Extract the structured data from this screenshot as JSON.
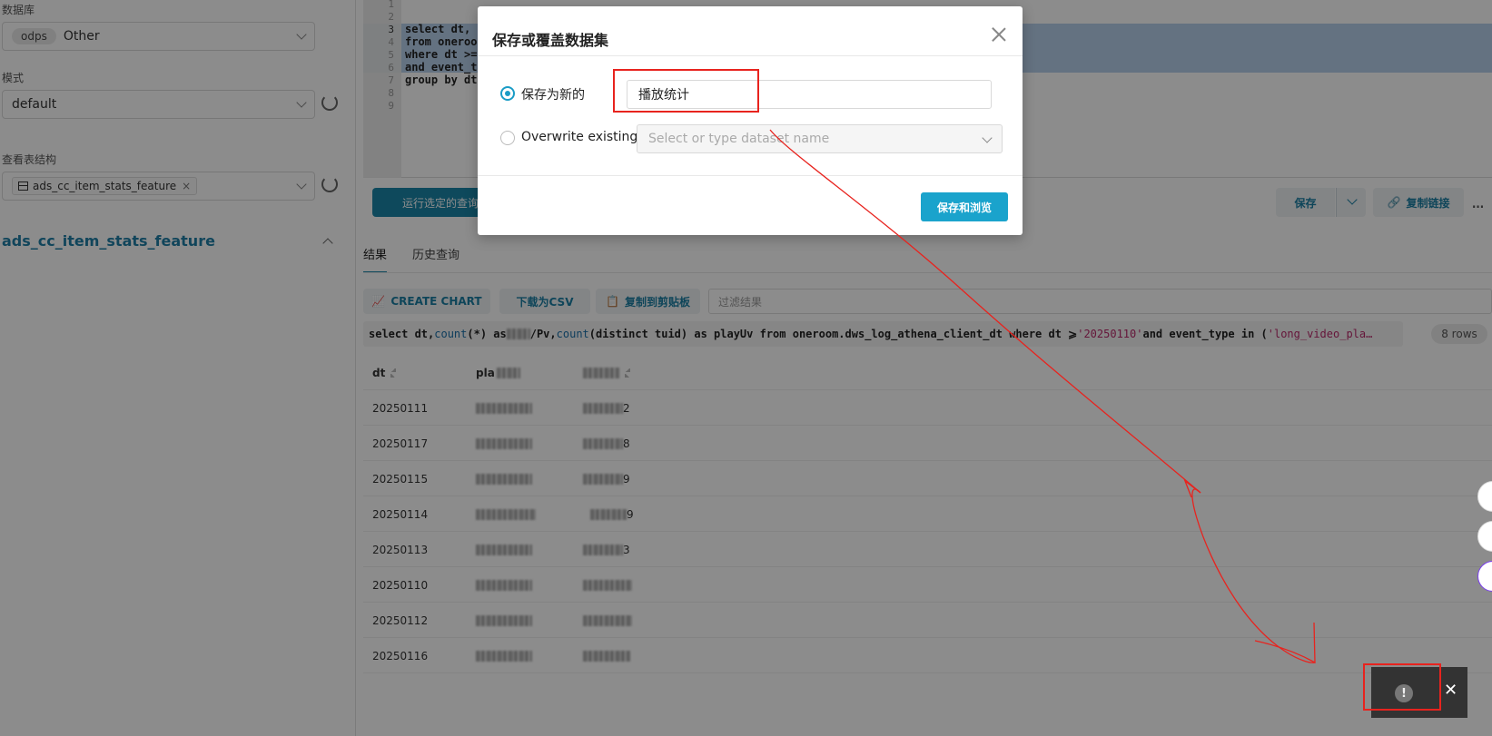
{
  "left_panel": {
    "database_label": "数据库",
    "database_chip": "odps",
    "database_value": "Other",
    "schema_label": "模式",
    "schema_value": "default",
    "table_label": "查看表结构",
    "table_tag": "ads_cc_item_stats_feature",
    "table_tag_remove": "×",
    "table_title": "ads_cc_item_stats_feature"
  },
  "editor": {
    "line_numbers": [
      "1",
      "2",
      "3",
      "4",
      "5",
      "6",
      "7",
      "8",
      "9"
    ],
    "code_lines": [
      "select dt,",
      "from oneroo",
      "where dt >=",
      "and event_t",
      "group by dt"
    ]
  },
  "toolbar": {
    "run_label": "运行选定的查询",
    "save_label": "保存",
    "copy_link_label": "复制链接",
    "more_label": "..."
  },
  "results": {
    "tabs": [
      "结果",
      "历史查询"
    ],
    "create_chart_label": "CREATE CHART",
    "download_csv_label": "下载为CSV",
    "copy_clipboard_label": "复制到剪贴板",
    "filter_placeholder": "过滤结果",
    "query_text": {
      "p1": "select dt, ",
      "f1": "count",
      "p2": "(*) as ",
      "blur1": "",
      "p3": "/Pv, ",
      "f2": "count",
      "p4": "(distinct tuid) as playUv from oneroom.dws_log_athena_client_dt where dt ⩾",
      "s1": "'20250110'",
      "p5": " and event_type in (",
      "s2": "'long_video_pla…"
    },
    "rows_badge": "8 rows",
    "columns": [
      "dt",
      "pla"
    ],
    "rows": [
      {
        "dt": "20250111",
        "tail": "2"
      },
      {
        "dt": "20250117",
        "tail": "8"
      },
      {
        "dt": "20250115",
        "tail": "9"
      },
      {
        "dt": "20250114",
        "tail": "9"
      },
      {
        "dt": "20250113",
        "tail": "3"
      },
      {
        "dt": "20250110",
        "tail": ""
      },
      {
        "dt": "20250112",
        "tail": ""
      },
      {
        "dt": "20250116",
        "tail": ""
      }
    ]
  },
  "modal": {
    "title": "保存或覆盖数据集",
    "option_new_label": "保存为新的",
    "name_value": "播放统计",
    "option_overwrite_label": "Overwrite existing",
    "overwrite_placeholder": "Select or type dataset name",
    "save_browse_label": "保存和浏览"
  },
  "toast": {
    "icon": "!",
    "close": "✕"
  },
  "colors": {
    "accent": "#1a85a8",
    "annotation_red": "#e8231e"
  }
}
